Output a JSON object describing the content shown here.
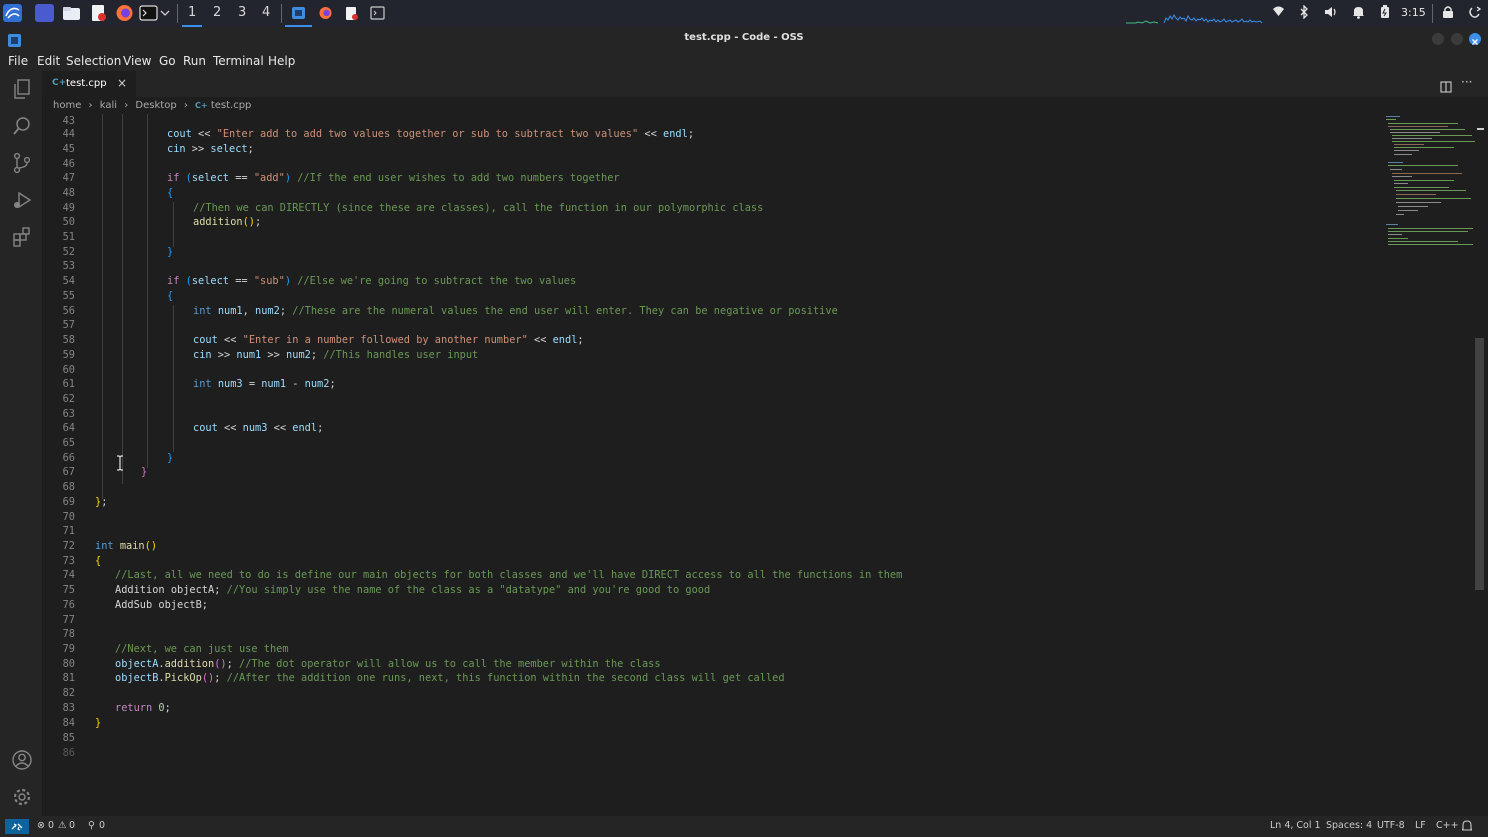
{
  "os_panel": {
    "workspaces": [
      "1",
      "2",
      "3",
      "4"
    ],
    "clock": "3:15"
  },
  "window": {
    "title": "test.cpp - Code - OSS"
  },
  "menu": [
    "File",
    "Edit",
    "Selection",
    "View",
    "Go",
    "Run",
    "Terminal",
    "Help"
  ],
  "tab": {
    "label": "test.cpp",
    "close": "×"
  },
  "breadcrumb": [
    "home",
    "kali",
    "Desktop",
    "test.cpp"
  ],
  "editor": {
    "lines": [
      {
        "n": "43",
        "t": ""
      },
      {
        "n": "44",
        "t": "cout << \"Enter add to add two values together or sub to subtract two values\" << endl;"
      },
      {
        "n": "45",
        "t": "cin >> select;"
      },
      {
        "n": "46",
        "t": ""
      },
      {
        "n": "47",
        "t": "if (select == \"add\") //If the end user wishes to add two numbers together"
      },
      {
        "n": "48",
        "t": "{"
      },
      {
        "n": "49",
        "t": "//Then we can DIRECTLY (since these are classes), call the function in our polymorphic class"
      },
      {
        "n": "50",
        "t": "addition();"
      },
      {
        "n": "51",
        "t": ""
      },
      {
        "n": "52",
        "t": "}"
      },
      {
        "n": "53",
        "t": ""
      },
      {
        "n": "54",
        "t": "if (select == \"sub\") //Else we're going to subtract the two values"
      },
      {
        "n": "55",
        "t": "{"
      },
      {
        "n": "56",
        "t": "int num1, num2; //These are the numeral values the end user will enter. They can be negative or positive"
      },
      {
        "n": "57",
        "t": ""
      },
      {
        "n": "58",
        "t": "cout << \"Enter in a number followed by another number\" << endl;"
      },
      {
        "n": "59",
        "t": "cin >> num1 >> num2; //This handles user input"
      },
      {
        "n": "60",
        "t": ""
      },
      {
        "n": "61",
        "t": "int num3 = num1 - num2;"
      },
      {
        "n": "62",
        "t": ""
      },
      {
        "n": "63",
        "t": ""
      },
      {
        "n": "64",
        "t": "cout << num3 << endl;"
      },
      {
        "n": "65",
        "t": ""
      },
      {
        "n": "66",
        "t": "}"
      },
      {
        "n": "67",
        "t": "}"
      },
      {
        "n": "68",
        "t": ""
      },
      {
        "n": "69",
        "t": "};"
      },
      {
        "n": "70",
        "t": ""
      },
      {
        "n": "71",
        "t": ""
      },
      {
        "n": "72",
        "t": "int main()"
      },
      {
        "n": "73",
        "t": "{"
      },
      {
        "n": "74",
        "t": "//Last, all we need to do is define our main objects for both classes and we'll have DIRECT access to all the functions in them"
      },
      {
        "n": "75",
        "t": "Addition objectA; //You simply use the name of the class as a \"datatype\" and you're good to good"
      },
      {
        "n": "76",
        "t": "AddSub objectB;"
      },
      {
        "n": "77",
        "t": ""
      },
      {
        "n": "78",
        "t": ""
      },
      {
        "n": "79",
        "t": "//Next, we can just use them"
      },
      {
        "n": "80",
        "t": "objectA.addition(); //The dot operator will allow us to call the member within the class"
      },
      {
        "n": "81",
        "t": "objectB.PickOp(); //After the addition one runs, next, this function within the second class will get called"
      },
      {
        "n": "82",
        "t": ""
      },
      {
        "n": "83",
        "t": "return 0;"
      },
      {
        "n": "84",
        "t": "}"
      },
      {
        "n": "85",
        "t": ""
      },
      {
        "n": "86",
        "t": ""
      }
    ]
  },
  "status": {
    "errors": "0",
    "warnings": "0",
    "ports": "0",
    "position": "Ln 4, Col 1",
    "spaces": "Spaces: 4",
    "encoding": "UTF-8",
    "eol": "LF",
    "language": "C++"
  },
  "colors": {
    "keyword": "#569cd6",
    "string": "#ce9178",
    "comment": "#6a9955",
    "function": "#dcdcaa",
    "variable": "#9cdcfe",
    "bracket_gold": "#ffd700",
    "bracket_orchid": "#da70d6",
    "bracket_blue": "#179fff",
    "accent": "#0e639c"
  }
}
